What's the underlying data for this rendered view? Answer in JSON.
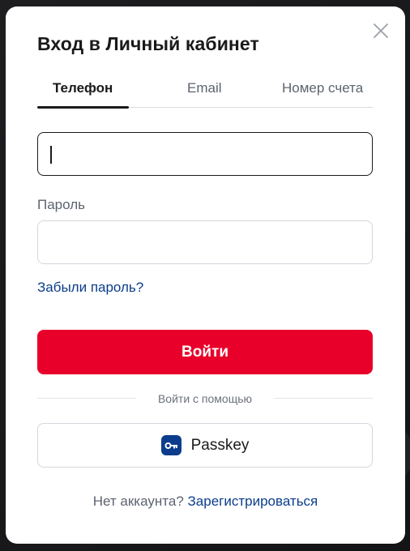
{
  "modal": {
    "title": "Вход в Личный кабинет",
    "close_icon": "close-icon"
  },
  "tabs": [
    {
      "label": "Телефон",
      "active": true
    },
    {
      "label": "Email",
      "active": false
    },
    {
      "label": "Номер счета",
      "active": false
    }
  ],
  "form": {
    "phone_value": "",
    "password_label": "Пароль",
    "password_value": "",
    "forgot_label": "Забыли пароль?",
    "submit_label": "Войти"
  },
  "alt_login": {
    "divider_text": "Войти с помощью",
    "passkey_label": "Passkey",
    "passkey_icon": "key-icon"
  },
  "footer": {
    "no_account_text": "Нет аккаунта?",
    "register_label": "Зарегистрироваться"
  },
  "colors": {
    "primary_red": "#e8002a",
    "link_blue": "#0b3d8c",
    "text_dark": "#1a1a1a",
    "text_muted": "#5c6370"
  }
}
